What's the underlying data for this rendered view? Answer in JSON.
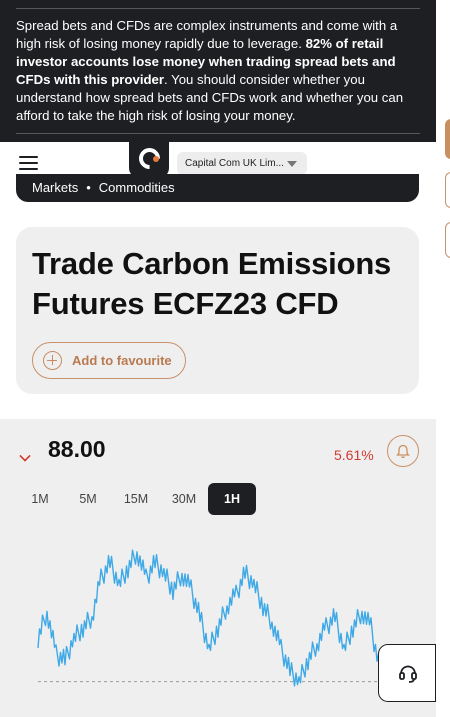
{
  "risk_warning": {
    "part1": "Spread bets and CFDs are complex instruments and come with a high risk of losing money rapidly due to leverage. ",
    "bold": "82% of retail investor accounts lose money when trading spread bets and CFDs with this provider",
    "part2": ". You should consider whether you understand how spread bets and CFDs work and whether you can afford to take the high risk of losing your money."
  },
  "header": {
    "entity_selector": "Capital Com UK Lim..."
  },
  "breadcrumb": {
    "items": [
      "Markets",
      "Commodities"
    ],
    "separator": "•"
  },
  "instrument": {
    "title": "Trade Carbon Emissions Futures ECFZ23 CFD",
    "favourite_label": "Add to favourite"
  },
  "quote": {
    "price": "88.00",
    "change": "5.61%",
    "direction": "down"
  },
  "timeframes": {
    "items": [
      "1M",
      "5M",
      "15M",
      "30M",
      "1H"
    ],
    "active": "1H"
  },
  "colors": {
    "accent": "#c8905f",
    "negative": "#d13a2f",
    "chart_line": "#3fa9e6",
    "dark": "#1d1f22"
  },
  "chart_data": {
    "type": "line",
    "series": [
      {
        "values": [
          74,
          79,
          71,
          70,
          74,
          76,
          78,
          85,
          88,
          84,
          87,
          90,
          85,
          88,
          86,
          83,
          86,
          83,
          78,
          72,
          76,
          80,
          82,
          86,
          84,
          80,
          77,
          72,
          68,
          66,
          70,
          73,
          76,
          78,
          72,
          76,
          79,
          76,
          68
        ]
      }
    ],
    "reference_line": 66,
    "ylim": [
      60,
      92
    ]
  }
}
